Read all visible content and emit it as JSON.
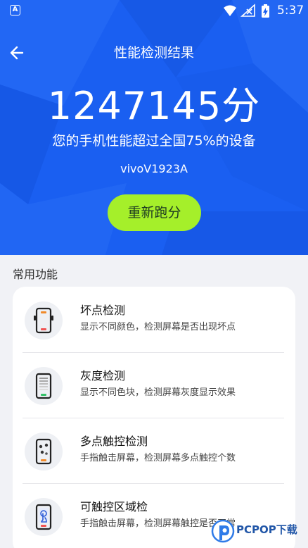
{
  "status_bar": {
    "app_indicator": "A",
    "time": "5:37",
    "icons": [
      "wifi-icon",
      "signal-icon",
      "battery-charging-icon"
    ]
  },
  "header": {
    "title": "性能检测结果",
    "back_icon": "arrow-left-icon"
  },
  "result": {
    "score": "1247145分",
    "summary": "您的手机性能超过全国75%的设备",
    "device": "vivoV1923A",
    "rerun_label": "重新跑分"
  },
  "features": {
    "section_title": "常用功能",
    "items": [
      {
        "name": "坏点检测",
        "desc": "显示不同颜色，检测屏幕是否出现坏点",
        "icon": "phone-dead-pixel-icon"
      },
      {
        "name": "灰度检测",
        "desc": "显示不同色块，检测屏幕灰度显示效果",
        "icon": "phone-grayscale-icon"
      },
      {
        "name": "多点触控检测",
        "desc": "手指触击屏幕，检测屏幕多点触控个数",
        "icon": "phone-multitouch-icon"
      },
      {
        "name": "可触控区域检",
        "desc": "手指触击屏幕，检测屏幕触控是否正常",
        "icon": "phone-touch-area-icon"
      }
    ]
  },
  "watermark": {
    "text": "PCPOP下载",
    "icon": "pcpop-logo-icon"
  },
  "colors": {
    "hero_bg": "#1a5ff1",
    "button_bg": "#a5ef2a",
    "page_bg": "#f1f2f6",
    "card_bg": "#ffffff"
  }
}
